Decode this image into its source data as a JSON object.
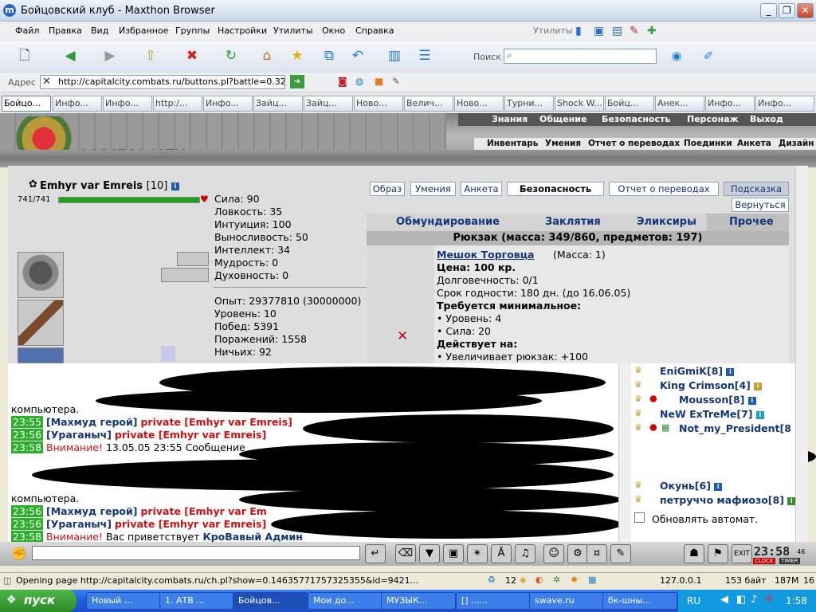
{
  "window": {
    "title": "Бойцовский клуб - Maxthon Browser"
  },
  "menu": [
    "Файл",
    "Правка",
    "Вид",
    "Избранное",
    "Группы",
    "Настройки",
    "Утилиты",
    "Окно",
    "Справка"
  ],
  "utilities_label": "Утилиты",
  "search": {
    "label": "Поиск",
    "value": ""
  },
  "address": {
    "label": "Адрес",
    "url": "http://capitalcity.combats.ru/buttons.pl?battle=0.328€"
  },
  "tabs": [
    "Бойцо...",
    "Инфо...",
    "Инфо...",
    "http:/...",
    "Инфо...",
    "Зайц...",
    "Зайц...",
    "Ново...",
    "Велич...",
    "Ново...",
    "Турни...",
    "Shock W...",
    "Бойц...",
    "Анек...",
    "Инфо...",
    "Инфо..."
  ],
  "game": {
    "logo": "CAPITALCITY",
    "nav_top": [
      "Знания",
      "Общение",
      "Безопасность",
      "Персонаж",
      "Выход"
    ],
    "nav_sub": [
      "Инвентарь",
      "Умения",
      "Отчет о переводах",
      "Поединки",
      "Анкета",
      "Дизайн"
    ],
    "player": {
      "name": "Emhyr var Emreis",
      "level": "[10]",
      "hp_text": "741/741",
      "hp_percent": 100
    },
    "stats": [
      "Сила: 90",
      "Ловкость: 35",
      "Интуиция: 100",
      "Выносливость: 50",
      "Интеллект: 34",
      "Мудрость: 0",
      "Духовность: 0"
    ],
    "stats2": [
      "Опыт: 29377810 (30000000)",
      "Уровень: 10",
      "Побед: 5391",
      "Поражений: 1558",
      "Ничьих: 92"
    ],
    "buttons": [
      "Образ",
      "Умения",
      "Анкета",
      "Безопасность",
      "Отчет о переводах",
      "Подсказка",
      "Вернуться"
    ],
    "inv_tabs": [
      "Обмундирование",
      "Заклятия",
      "Эликсиры",
      "Прочее"
    ],
    "inv_header": "Рюкзак (масса: 349/860, предметов: 197)",
    "item": {
      "name": "Мешок Торговца",
      "mass": "(Масса: 1)",
      "price": "Цена: 100 кр.",
      "durability": "Долговечность: 0/1",
      "expiry": "Срок годности: 180 дн. (до 16.06.05)",
      "req_title": "Требуется минимальное:",
      "req1": "• Уровень: 4",
      "req2": "• Сила: 20",
      "effect_title": "Действует на:",
      "effect1": "• Увеличивает рюкзак: +100"
    }
  },
  "chat": {
    "line1_ts": "23:56",
    "line1_text": "компьютера.",
    "line2_ts": "23:55",
    "line2_nick": "[Махмуд герой]",
    "line2_private": "private [Emhyr var Emreis]",
    "line3_ts": "23:56",
    "line3_nick": "[Ураганыч]",
    "line3_private": "private [Emhyr var Emreis]",
    "line4_ts": "23:58",
    "line4_warn": "Внимание!",
    "line4_text": "13.05.05 23:55 Сообщение",
    "line5_text": "компьютера.",
    "line6_ts": "23:55",
    "line6_nick": "[Махмуд герой]",
    "line6_private": "private [Emhyr var Em",
    "line7_ts": "23:56",
    "line7_nick": "[Ураганыч]",
    "line7_private": "private [Emhyr var Emreis]",
    "line8_ts": "23:58",
    "line8_warn": "Внимание!",
    "line8_text": "Вас приветствует",
    "line8_admin": "КроВавый Админ"
  },
  "users": {
    "u1": "EniGmiK[8]",
    "u2": "King Crimson[4]",
    "u3": "Mousson[8]",
    "u4": "NeW ExTreMe[7]",
    "u5": "Not_my_President[8",
    "u6": "Окунь[6]",
    "u7": "петруччо мафиозо[8]",
    "auto": "Обновлять автомат."
  },
  "clock": {
    "time": "23:58",
    "sec": "46",
    "clock_label": "CLOCK",
    "timer_label": "TIMER"
  },
  "status": {
    "text": "Opening page http://capitalcity.combats.ru/ch.pl?show=0.14635771757325355&id=9421...",
    "n12": "12",
    "ip": "127.0.0.1",
    "bytes": "153 байт",
    "mem": "187M",
    "n16": "16"
  },
  "taskbar": {
    "start": "пуск",
    "tasks": [
      "Новый ...",
      "1. АТВ ...",
      "Бойцов...",
      "Мои до...",
      "МУЗЫК...",
      "[] ......",
      "swave.ru",
      "бк-шны..."
    ],
    "lang": "RU",
    "time": "1:58"
  }
}
